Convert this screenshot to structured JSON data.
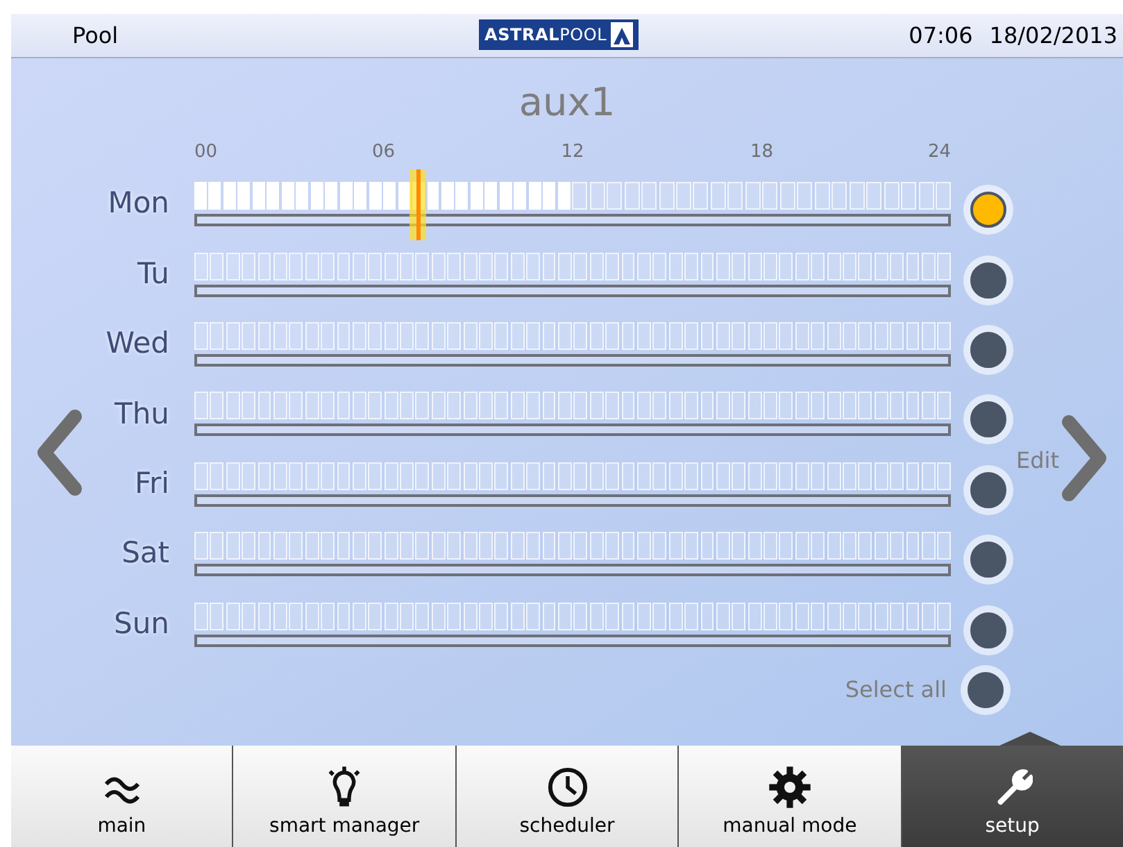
{
  "header": {
    "title": "Pool",
    "logo": "**ASTRAL**POOL",
    "time": "07:06",
    "date": "18/02/2013"
  },
  "schedule": {
    "title": "aux1",
    "ticks": [
      "00",
      "06",
      "12",
      "18",
      "24"
    ],
    "days": [
      {
        "label": "Mon",
        "selected": true,
        "slots": [
          true,
          true,
          true,
          true,
          true,
          true,
          true,
          true,
          true,
          true,
          true,
          true,
          true,
          true,
          true,
          true,
          true,
          true,
          true,
          true,
          true,
          true,
          true,
          true,
          true,
          true,
          false,
          false,
          false,
          false,
          false,
          false,
          false,
          false,
          false,
          false,
          false,
          false,
          false,
          false,
          false,
          false,
          false,
          false,
          false,
          false,
          false,
          false
        ]
      },
      {
        "label": "Tu",
        "selected": false,
        "slots": [
          false,
          false,
          false,
          false,
          false,
          false,
          false,
          false,
          false,
          false,
          false,
          false,
          false,
          false,
          false,
          false,
          false,
          false,
          false,
          false,
          false,
          false,
          false,
          false,
          false,
          false,
          false,
          false,
          false,
          false,
          false,
          false,
          false,
          false,
          false,
          false,
          false,
          false,
          false,
          false,
          false,
          false,
          false,
          false,
          false,
          false,
          false,
          false
        ]
      },
      {
        "label": "Wed",
        "selected": false,
        "slots": [
          false,
          false,
          false,
          false,
          false,
          false,
          false,
          false,
          false,
          false,
          false,
          false,
          false,
          false,
          false,
          false,
          false,
          false,
          false,
          false,
          false,
          false,
          false,
          false,
          false,
          false,
          false,
          false,
          false,
          false,
          false,
          false,
          false,
          false,
          false,
          false,
          false,
          false,
          false,
          false,
          false,
          false,
          false,
          false,
          false,
          false,
          false,
          false
        ]
      },
      {
        "label": "Thu",
        "selected": false,
        "slots": [
          false,
          false,
          false,
          false,
          false,
          false,
          false,
          false,
          false,
          false,
          false,
          false,
          false,
          false,
          false,
          false,
          false,
          false,
          false,
          false,
          false,
          false,
          false,
          false,
          false,
          false,
          false,
          false,
          false,
          false,
          false,
          false,
          false,
          false,
          false,
          false,
          false,
          false,
          false,
          false,
          false,
          false,
          false,
          false,
          false,
          false,
          false,
          false
        ]
      },
      {
        "label": "Fri",
        "selected": false,
        "slots": [
          false,
          false,
          false,
          false,
          false,
          false,
          false,
          false,
          false,
          false,
          false,
          false,
          false,
          false,
          false,
          false,
          false,
          false,
          false,
          false,
          false,
          false,
          false,
          false,
          false,
          false,
          false,
          false,
          false,
          false,
          false,
          false,
          false,
          false,
          false,
          false,
          false,
          false,
          false,
          false,
          false,
          false,
          false,
          false,
          false,
          false,
          false,
          false
        ]
      },
      {
        "label": "Sat",
        "selected": false,
        "slots": [
          false,
          false,
          false,
          false,
          false,
          false,
          false,
          false,
          false,
          false,
          false,
          false,
          false,
          false,
          false,
          false,
          false,
          false,
          false,
          false,
          false,
          false,
          false,
          false,
          false,
          false,
          false,
          false,
          false,
          false,
          false,
          false,
          false,
          false,
          false,
          false,
          false,
          false,
          false,
          false,
          false,
          false,
          false,
          false,
          false,
          false,
          false,
          false
        ]
      },
      {
        "label": "Sun",
        "selected": false,
        "slots": [
          false,
          false,
          false,
          false,
          false,
          false,
          false,
          false,
          false,
          false,
          false,
          false,
          false,
          false,
          false,
          false,
          false,
          false,
          false,
          false,
          false,
          false,
          false,
          false,
          false,
          false,
          false,
          false,
          false,
          false,
          false,
          false,
          false,
          false,
          false,
          false,
          false,
          false,
          false,
          false,
          false,
          false,
          false,
          false,
          false,
          false,
          false,
          false
        ]
      }
    ],
    "select_all": {
      "label": "Select all",
      "selected": false
    },
    "edit_label": "Edit"
  },
  "nav": [
    {
      "kind": "waves",
      "label": "main",
      "selected": false
    },
    {
      "kind": "bulb",
      "label": "smart manager",
      "selected": false
    },
    {
      "kind": "clock",
      "label": "scheduler",
      "selected": false
    },
    {
      "kind": "gear",
      "label": "manual mode",
      "selected": false
    },
    {
      "kind": "wrench",
      "label": "setup",
      "selected": true
    }
  ]
}
